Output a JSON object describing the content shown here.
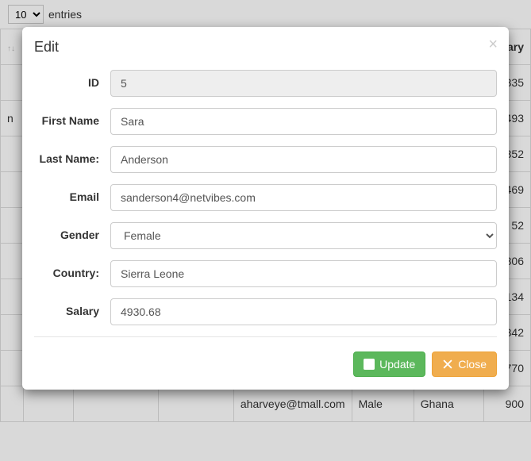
{
  "toolbar": {
    "page_size": "10",
    "entries_label": "entries"
  },
  "table": {
    "salary_header": "Salary",
    "salary_values": [
      "335",
      "493",
      "352",
      "469",
      "52",
      "806",
      "134",
      "342",
      "770",
      "900"
    ],
    "bottom_row": {
      "email": "aharveye@tmall.com",
      "gender": "Male",
      "country": "Ghana"
    }
  },
  "modal": {
    "title": "Edit",
    "labels": {
      "id": "ID",
      "first_name": "First Name",
      "last_name": "Last Name:",
      "email": "Email",
      "gender": "Gender",
      "country": "Country:",
      "salary": "Salary"
    },
    "values": {
      "id": "5",
      "first_name": "Sara",
      "last_name": "Anderson",
      "email": "sanderson4@netvibes.com",
      "gender": "Female",
      "country": "Sierra Leone",
      "salary": "4930.68"
    },
    "buttons": {
      "update": "Update",
      "close": "Close"
    }
  }
}
